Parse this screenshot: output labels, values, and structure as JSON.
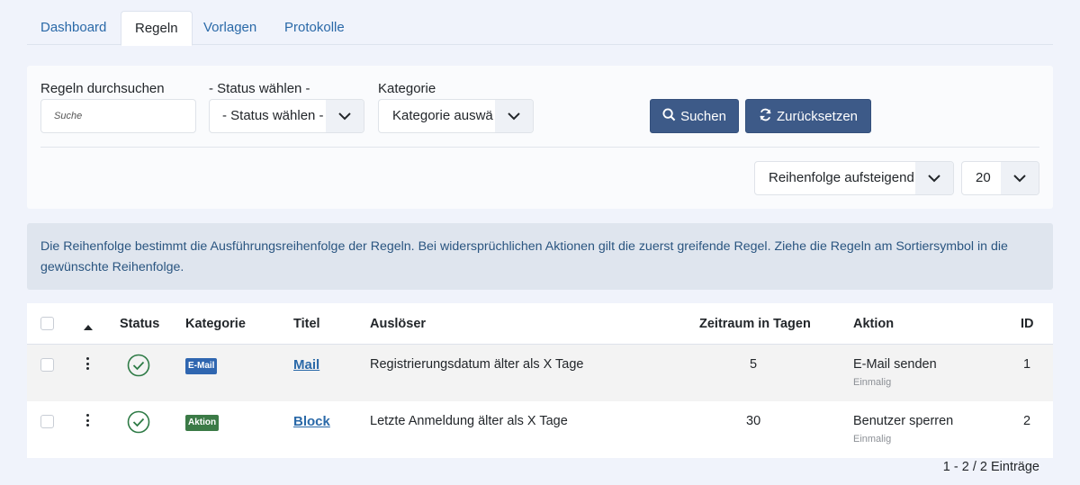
{
  "tabs": [
    {
      "label": "Dashboard",
      "active": false
    },
    {
      "label": "Regeln",
      "active": true
    },
    {
      "label": "Vorlagen",
      "active": false
    },
    {
      "label": "Protokolle",
      "active": false
    }
  ],
  "filters": {
    "search_label": "Regeln durchsuchen",
    "search_placeholder": "Suche",
    "status_label": "- Status wählen -",
    "status_value": "- Status wählen -",
    "category_label": "Kategorie",
    "category_value": "Kategorie auswä",
    "search_button": "Suchen",
    "reset_button": "Zurücksetzen",
    "order_value": "Reihenfolge aufsteigend",
    "limit_value": "20"
  },
  "alert": {
    "text": "Die Reihenfolge bestimmt die Ausführungsreihenfolge der Regeln. Bei widersprüchlichen Aktionen gilt die zuerst greifende Regel. Ziehe die Regeln am Sortiersymbol in die gewünschte Reihenfolge."
  },
  "table": {
    "headers": {
      "status": "Status",
      "category": "Kategorie",
      "title": "Titel",
      "trigger": "Auslöser",
      "days": "Zeitraum in Tagen",
      "action": "Aktion",
      "id": "ID"
    },
    "rows": [
      {
        "category": "E-Mail",
        "title": "Mail",
        "trigger": "Registrierungsdatum älter als X Tage",
        "days": "5",
        "action": "E-Mail senden",
        "action_sub": "Einmalig",
        "id": "1"
      },
      {
        "category": "Aktion",
        "title": "Block",
        "trigger": "Letzte Anmeldung älter als X Tage",
        "days": "30",
        "action": "Benutzer sperren",
        "action_sub": "Einmalig",
        "id": "2"
      }
    ]
  },
  "pagination": {
    "count_text": "1 - 2 / 2 Einträge"
  },
  "colors": {
    "primary_button": "#3d5a88",
    "link": "#2a69a8",
    "status_ok": "#2d7a45",
    "badge_mail": "#2f66b0",
    "badge_aktion": "#3b7a46"
  }
}
